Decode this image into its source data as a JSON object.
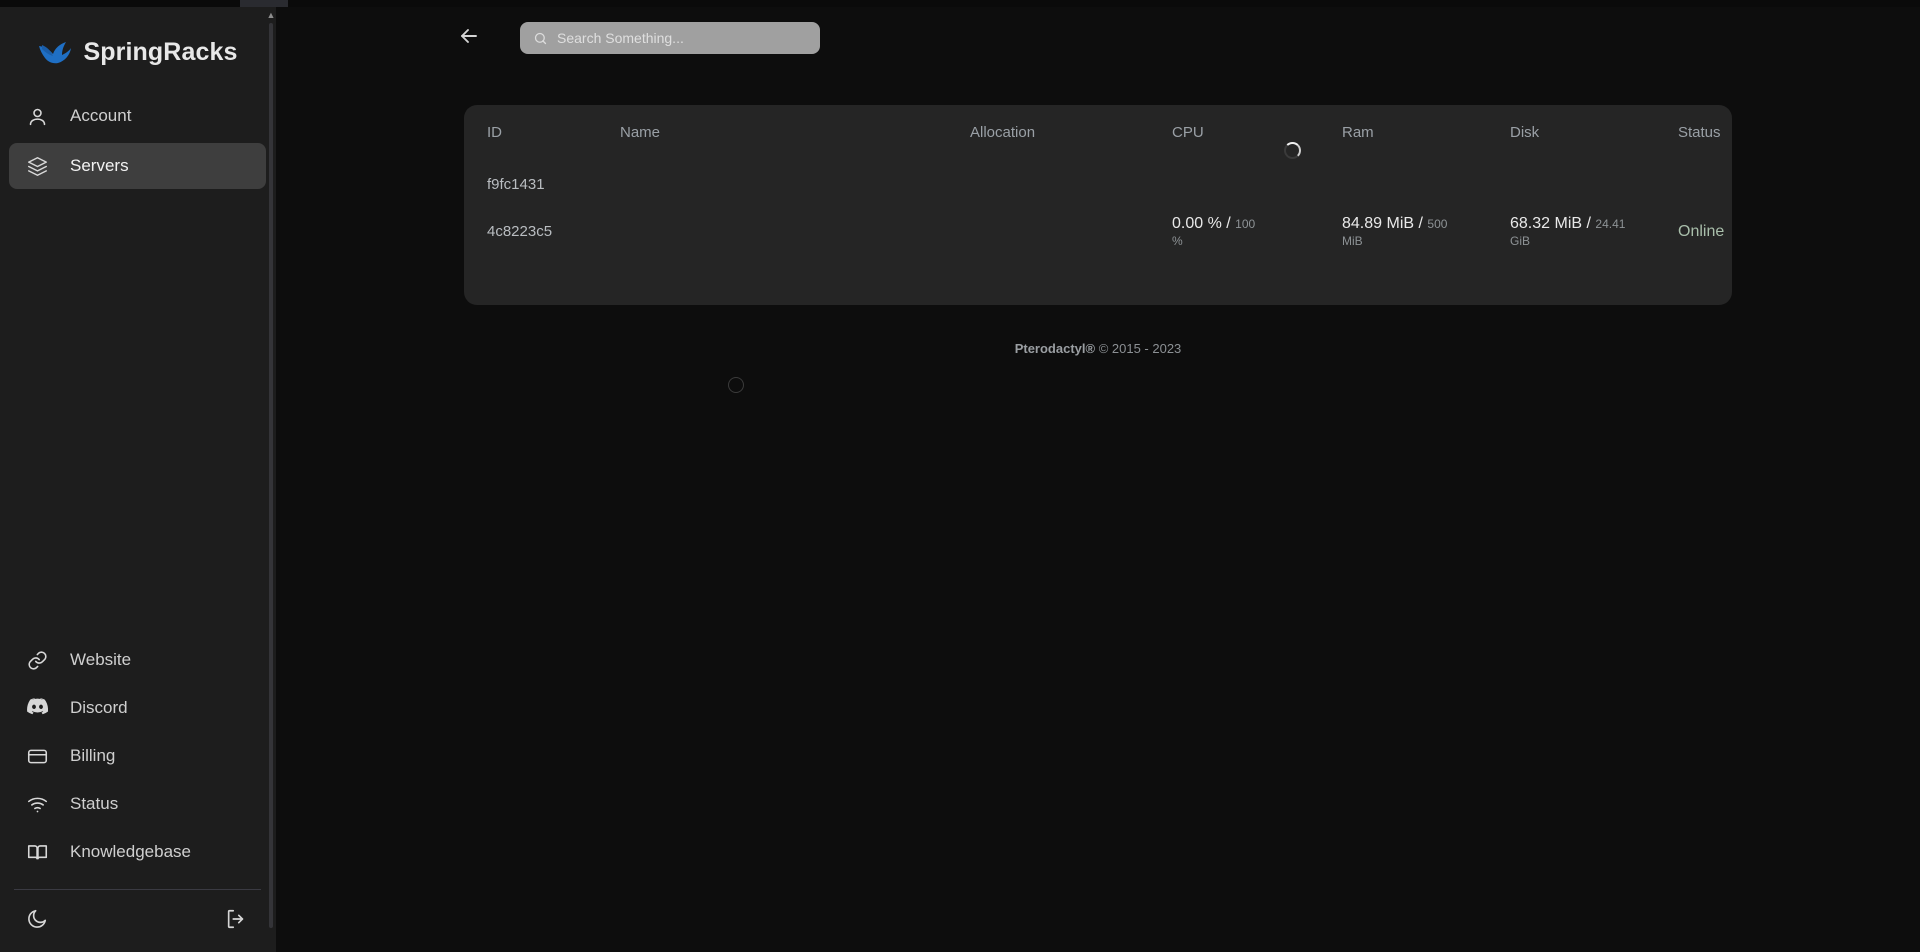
{
  "brand": {
    "name": "SpringRacks",
    "logo_icon": "pterodactyl-logo-icon",
    "logo_color": "#1f6fc4"
  },
  "sidebar": {
    "primary_items": [
      {
        "label": "Account",
        "icon": "user-icon",
        "active": false
      },
      {
        "label": "Servers",
        "icon": "layers-icon",
        "active": true
      }
    ],
    "secondary_items": [
      {
        "label": "Website",
        "icon": "link-icon"
      },
      {
        "label": "Discord",
        "icon": "discord-icon"
      },
      {
        "label": "Billing",
        "icon": "credit-card-icon"
      },
      {
        "label": "Status",
        "icon": "wifi-icon"
      },
      {
        "label": "Knowledgebase",
        "icon": "open-book-icon"
      }
    ],
    "footer": {
      "theme_toggle_icon": "moon-icon",
      "logout_icon": "logout-icon"
    },
    "active_color": "#3e3e3e",
    "background": "#1d1d1d"
  },
  "topbar": {
    "back_icon": "arrow-left-icon",
    "search": {
      "icon": "search-icon",
      "placeholder": "Search Something...",
      "value": ""
    }
  },
  "servers_table": {
    "columns": [
      "ID",
      "Name",
      "Allocation",
      "CPU",
      "Ram",
      "Disk",
      "Status"
    ],
    "rows": [
      {
        "id": "f9fc1431",
        "name": "",
        "allocation": "",
        "cpu_used": "",
        "cpu_limit": "",
        "cpu_unit": "",
        "ram_used": "",
        "ram_limit": "",
        "ram_unit": "",
        "disk_used": "",
        "disk_limit": "",
        "disk_unit": "",
        "status": "",
        "loading": true
      },
      {
        "id": "4c8223c5",
        "name": "",
        "allocation": "",
        "cpu_used": "0.00 % /",
        "cpu_limit": "100",
        "cpu_unit": "%",
        "ram_used": "84.89 MiB /",
        "ram_limit": "500",
        "ram_unit": "MiB",
        "disk_used": "68.32 MiB /",
        "disk_limit": "24.41",
        "disk_unit": "GiB",
        "status": "Online",
        "loading": false
      }
    ],
    "status_color": "#a9bfab",
    "card_background": "#252525"
  },
  "page_footer": {
    "brand": "Pterodactyl®",
    "copyright": "© 2015 - 2023"
  }
}
